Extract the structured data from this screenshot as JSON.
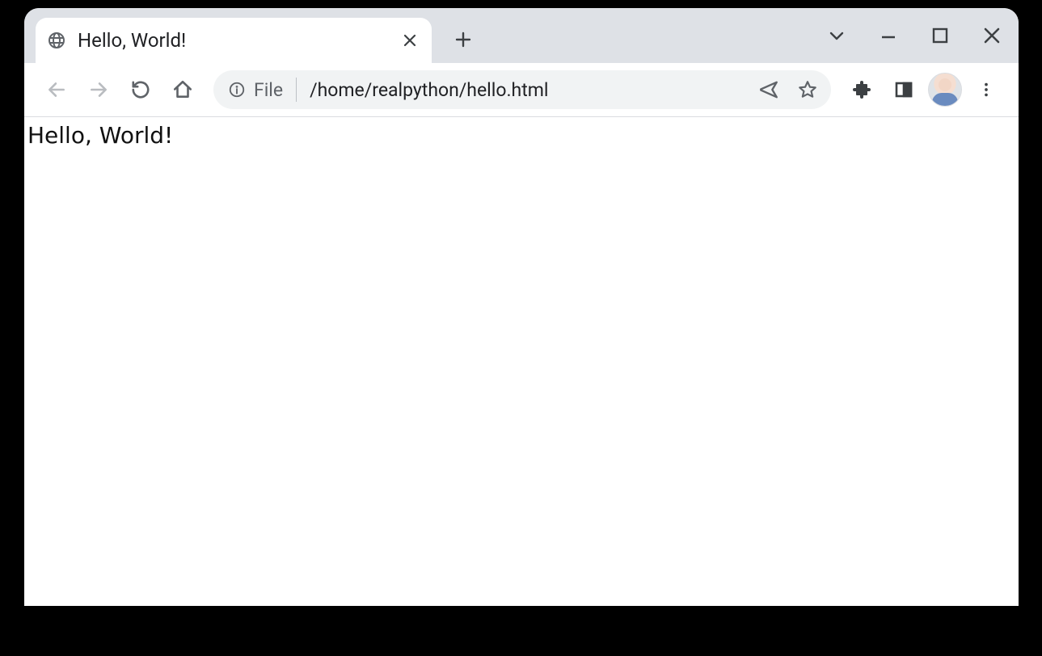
{
  "tab": {
    "title": "Hello, World!"
  },
  "omnibox": {
    "scheme_label": "File",
    "path": "/home/realpython/hello.html"
  },
  "page": {
    "body_text": "Hello, World!"
  }
}
